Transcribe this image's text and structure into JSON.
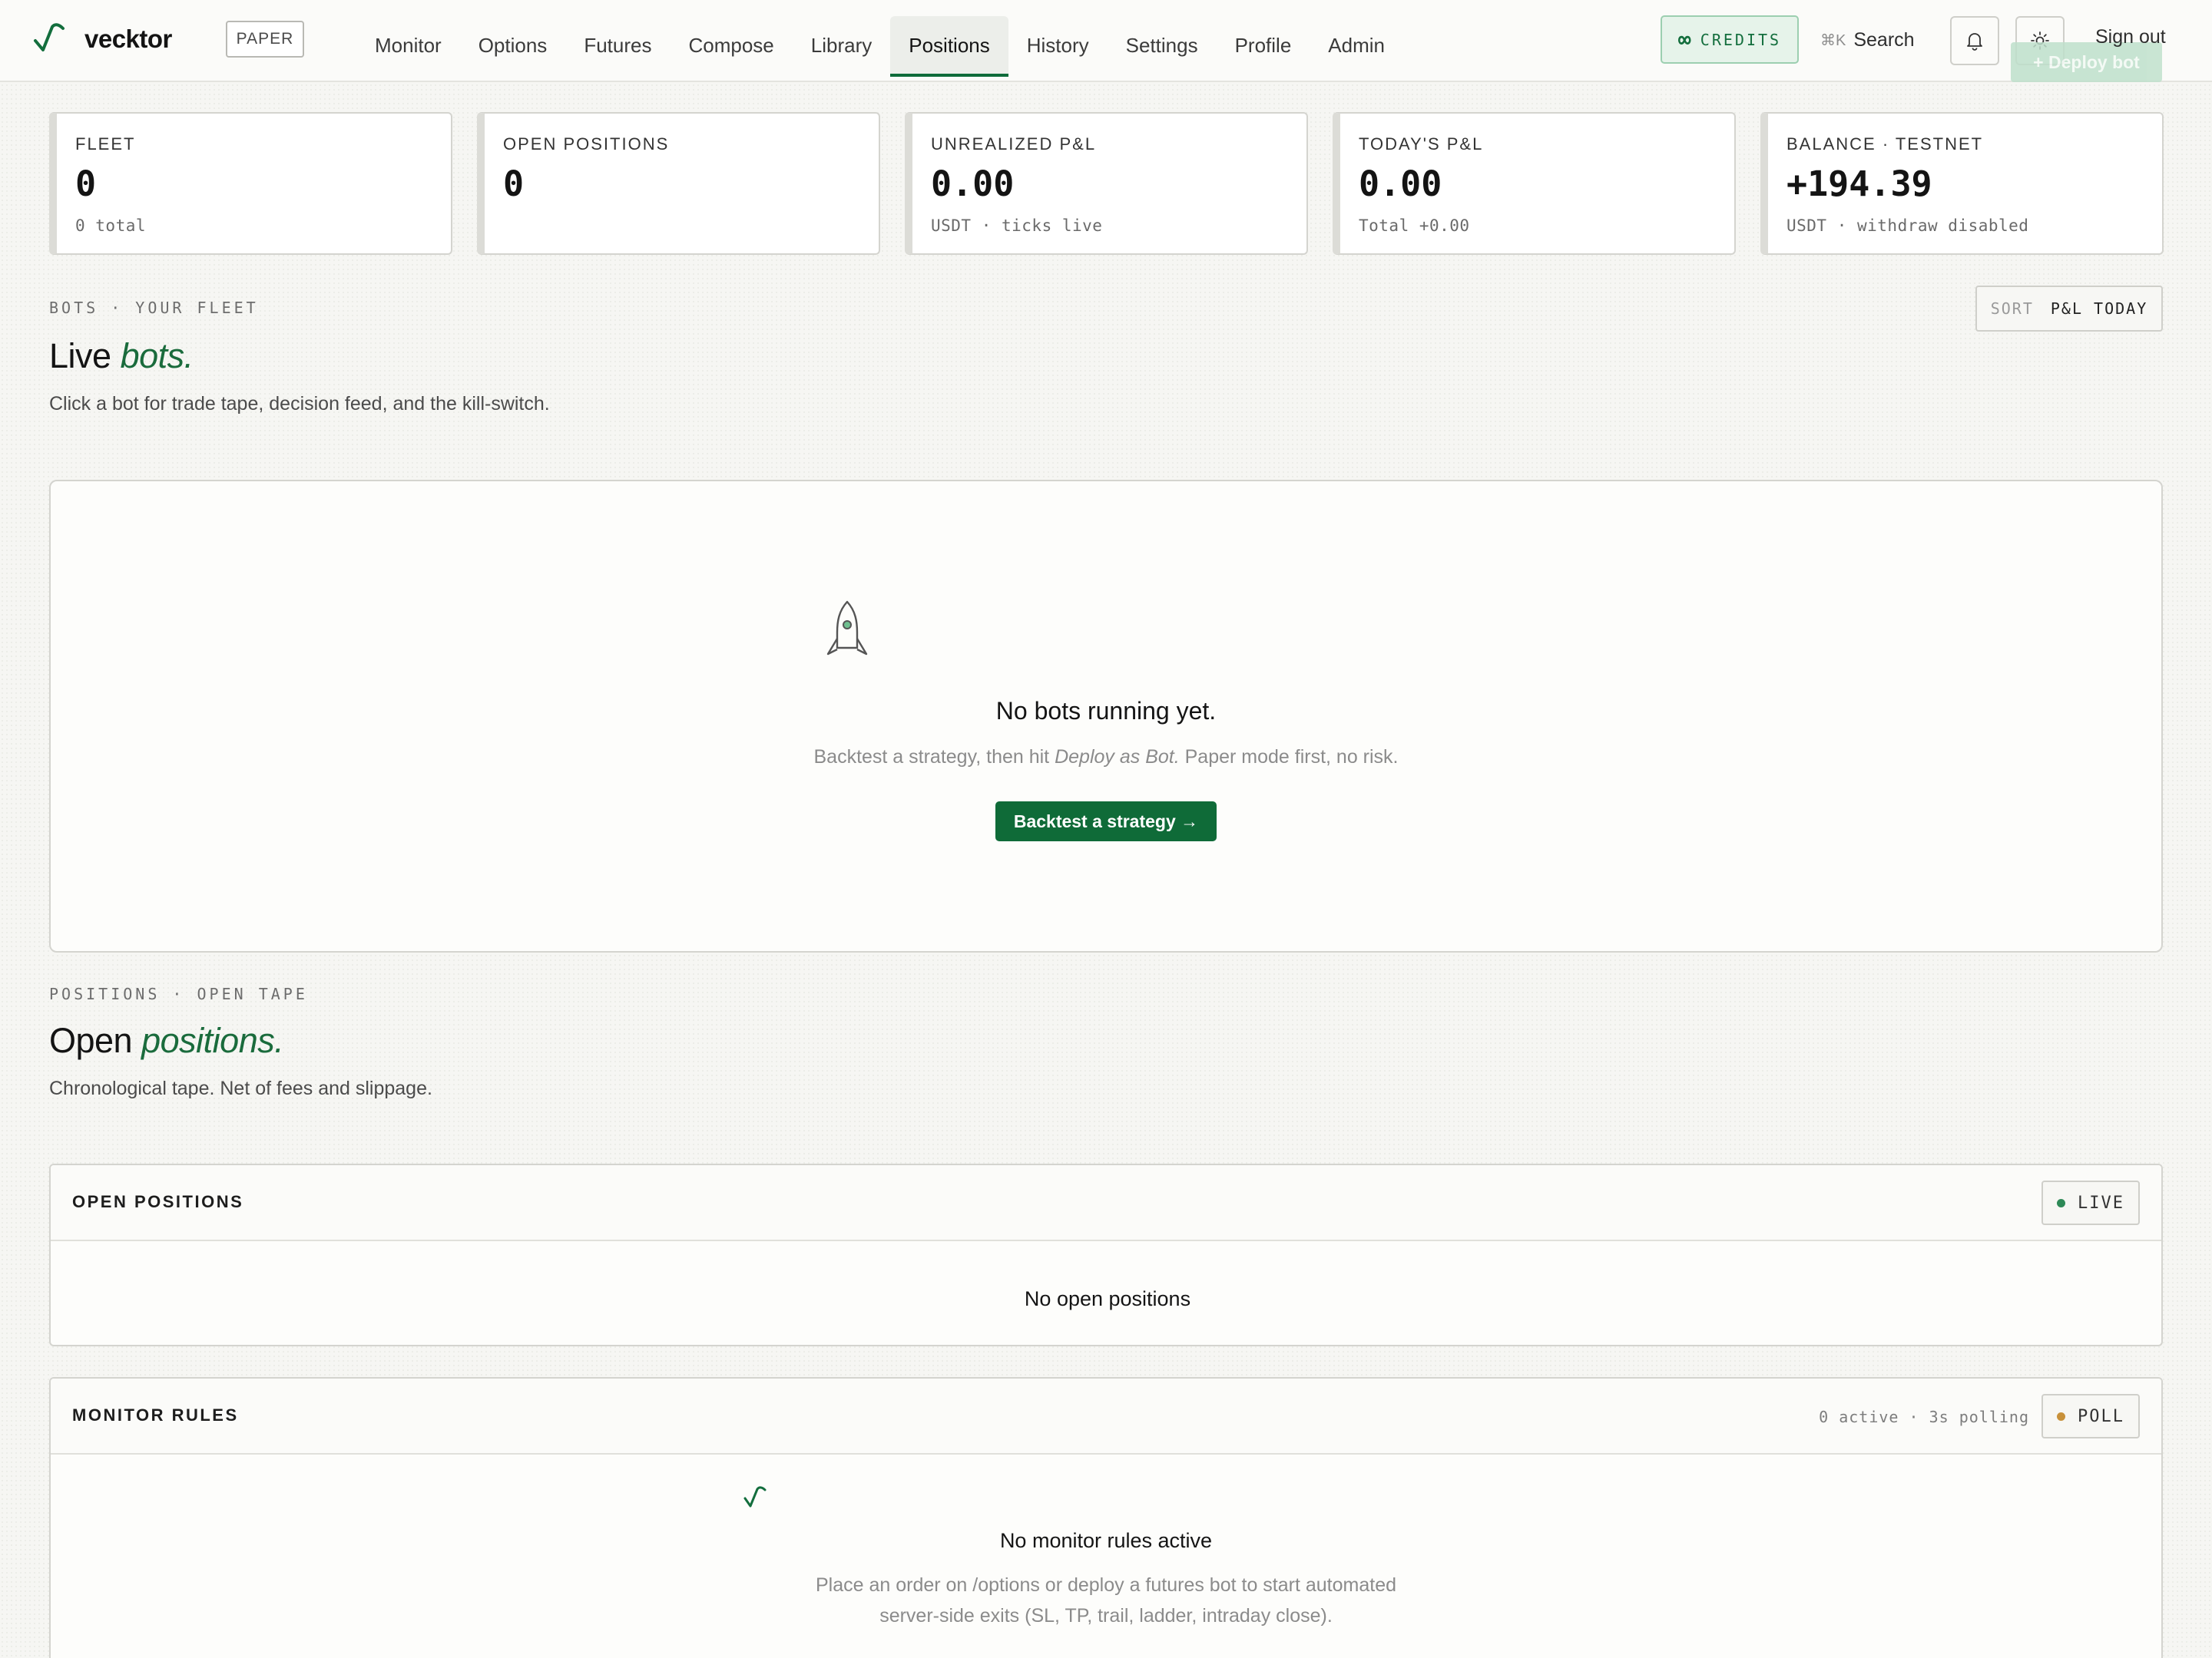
{
  "brand": {
    "name": "vecktor",
    "mode": "PAPER"
  },
  "nav": {
    "items": [
      "Monitor",
      "Options",
      "Futures",
      "Compose",
      "Library",
      "Positions",
      "History",
      "Settings",
      "Profile",
      "Admin"
    ],
    "active": "Positions"
  },
  "header": {
    "credits_icon": "∞",
    "credits_label": "CREDITS",
    "search_shortcut": "⌘K",
    "search_label": "Search",
    "signout_label": "Sign out",
    "deploy_label": "+ Deploy bot"
  },
  "stats": [
    {
      "label": "FLEET",
      "value": "0",
      "sub": "0 total"
    },
    {
      "label": "OPEN POSITIONS",
      "value": "0",
      "sub": ""
    },
    {
      "label": "UNREALIZED P&L",
      "value": "0.00",
      "sub": "USDT · ticks live"
    },
    {
      "label": "TODAY'S P&L",
      "value": "0.00",
      "sub": "Total +0.00"
    },
    {
      "label": "BALANCE · TESTNET",
      "value": "+194.39",
      "sub": "USDT · withdraw disabled"
    }
  ],
  "bots": {
    "eyebrow": "BOTS · YOUR FLEET",
    "title_plain": "Live",
    "title_em": "bots.",
    "description": "Click a bot for trade tape, decision feed, and the kill-switch.",
    "sort_key": "SORT",
    "sort_value": "P&L TODAY",
    "empty_title": "No bots running yet.",
    "empty_desc_a": "Backtest a strategy, then hit",
    "empty_desc_em": "Deploy as Bot.",
    "empty_desc_b": "Paper mode first, no risk.",
    "cta": "Backtest a strategy →"
  },
  "positions": {
    "eyebrow": "POSITIONS · OPEN TAPE",
    "title_plain": "Open",
    "title_em": "positions.",
    "description": "Chronological tape. Net of fees and slippage.",
    "panel_title": "OPEN POSITIONS",
    "status": "LIVE",
    "empty": "No open positions"
  },
  "monitor": {
    "panel_title": "MONITOR RULES",
    "meta": "0 active · 3s polling",
    "status": "POLL",
    "empty_title": "No monitor rules active",
    "empty_desc_1": "Place an order on /options or deploy a futures bot to start automated",
    "empty_desc_2": "server-side exits (SL, TP, trail, ladder, intraday close)."
  },
  "colors": {
    "accent": "#0f6b38",
    "live_dot": "#2e8a57",
    "poll_dot": "#c8913a"
  },
  "icons": [
    "logo-check-icon",
    "bell-icon",
    "sun-icon",
    "rocket-icon",
    "monitor-check-icon"
  ]
}
